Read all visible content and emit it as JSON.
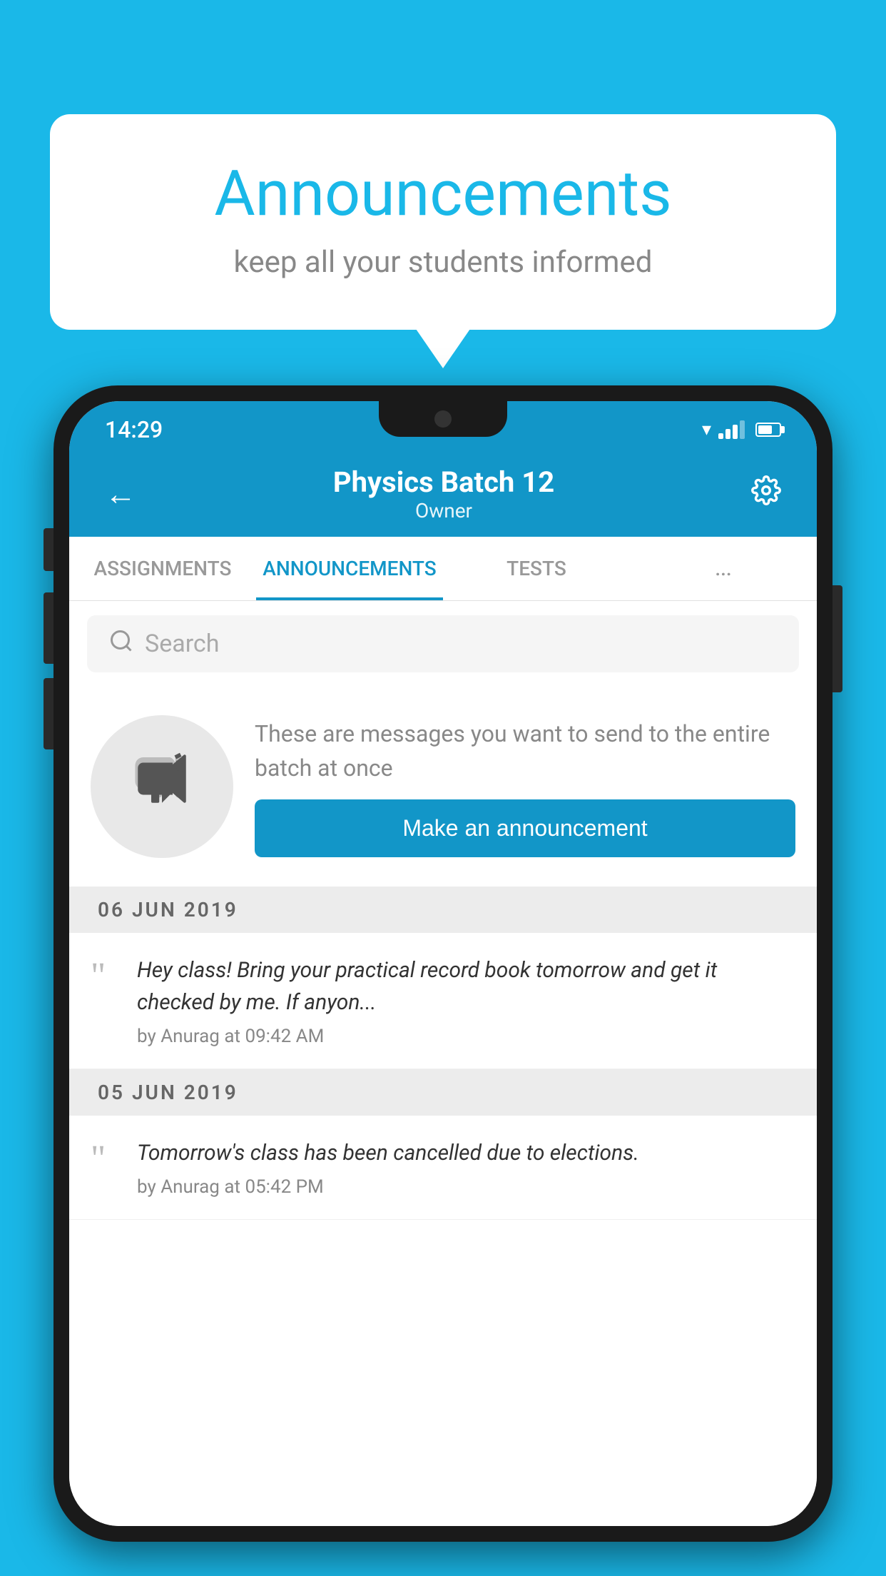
{
  "background_color": "#1ab8e8",
  "speech_bubble": {
    "title": "Announcements",
    "subtitle": "keep all your students informed"
  },
  "status_bar": {
    "time": "14:29"
  },
  "app_bar": {
    "title": "Physics Batch 12",
    "subtitle": "Owner",
    "back_label": "←"
  },
  "tabs": [
    {
      "label": "ASSIGNMENTS",
      "active": false
    },
    {
      "label": "ANNOUNCEMENTS",
      "active": true
    },
    {
      "label": "TESTS",
      "active": false
    },
    {
      "label": "...",
      "active": false
    }
  ],
  "search": {
    "placeholder": "Search"
  },
  "promo": {
    "text": "These are messages you want to send to the entire batch at once",
    "button_label": "Make an announcement"
  },
  "date_groups": [
    {
      "date": "06  JUN  2019",
      "items": [
        {
          "message": "Hey class! Bring your practical record book tomorrow and get it checked by me. If anyon...",
          "author": "by Anurag at 09:42 AM"
        }
      ]
    },
    {
      "date": "05  JUN  2019",
      "items": [
        {
          "message": "Tomorrow's class has been cancelled due to elections.",
          "author": "by Anurag at 05:42 PM"
        }
      ]
    }
  ]
}
